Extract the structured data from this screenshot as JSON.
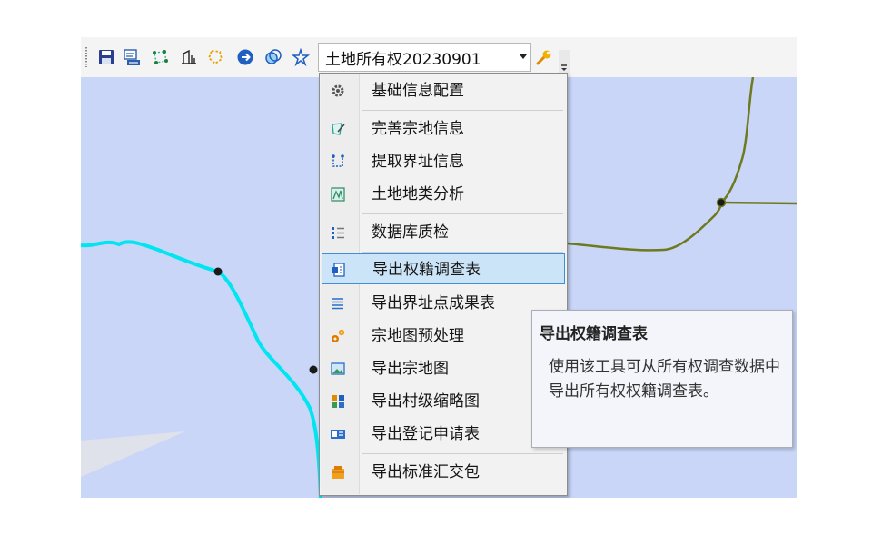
{
  "toolbar": {
    "icons": [
      "save-icon",
      "sql-query-icon",
      "point-select-icon",
      "ruler-icon",
      "polygon-icon",
      "navigate-icon",
      "overlay-icon",
      "star-tool-icon"
    ],
    "layer_combo": {
      "value": "土地所有权20230901"
    },
    "wrench_icon": "wrench-icon"
  },
  "menu": {
    "items": [
      {
        "label": "基础信息配置",
        "icon": "gear-icon"
      },
      {
        "label": "完善宗地信息",
        "icon": "edit-parcel-icon"
      },
      {
        "label": "提取界址信息",
        "icon": "boundary-extract-icon"
      },
      {
        "label": "土地地类分析",
        "icon": "land-analysis-icon"
      },
      {
        "label": "数据库质检",
        "icon": "checklist-icon"
      },
      {
        "label": "导出权籍调查表",
        "icon": "document-export-icon"
      },
      {
        "label": "导出界址点成果表",
        "icon": "list-icon"
      },
      {
        "label": "宗地图预处理",
        "icon": "cogs-icon"
      },
      {
        "label": "导出宗地图",
        "icon": "image-icon"
      },
      {
        "label": "导出村级缩略图",
        "icon": "thumbnail-grid-icon"
      },
      {
        "label": "导出登记申请表",
        "icon": "form-icon"
      },
      {
        "label": "导出标准汇交包",
        "icon": "package-icon"
      }
    ],
    "highlighted_index": 5
  },
  "tooltip": {
    "title": "导出权籍调查表",
    "body": "使用该工具可从所有权调查数据中导出所有权权籍调查表。"
  },
  "colors": {
    "map_background": "#c9d6f8",
    "cyan_line": "#00e5f0",
    "olive_line": "#6e7a1e",
    "menu_highlight": "#cce4f7",
    "menu_highlight_border": "#3d8fd8"
  }
}
